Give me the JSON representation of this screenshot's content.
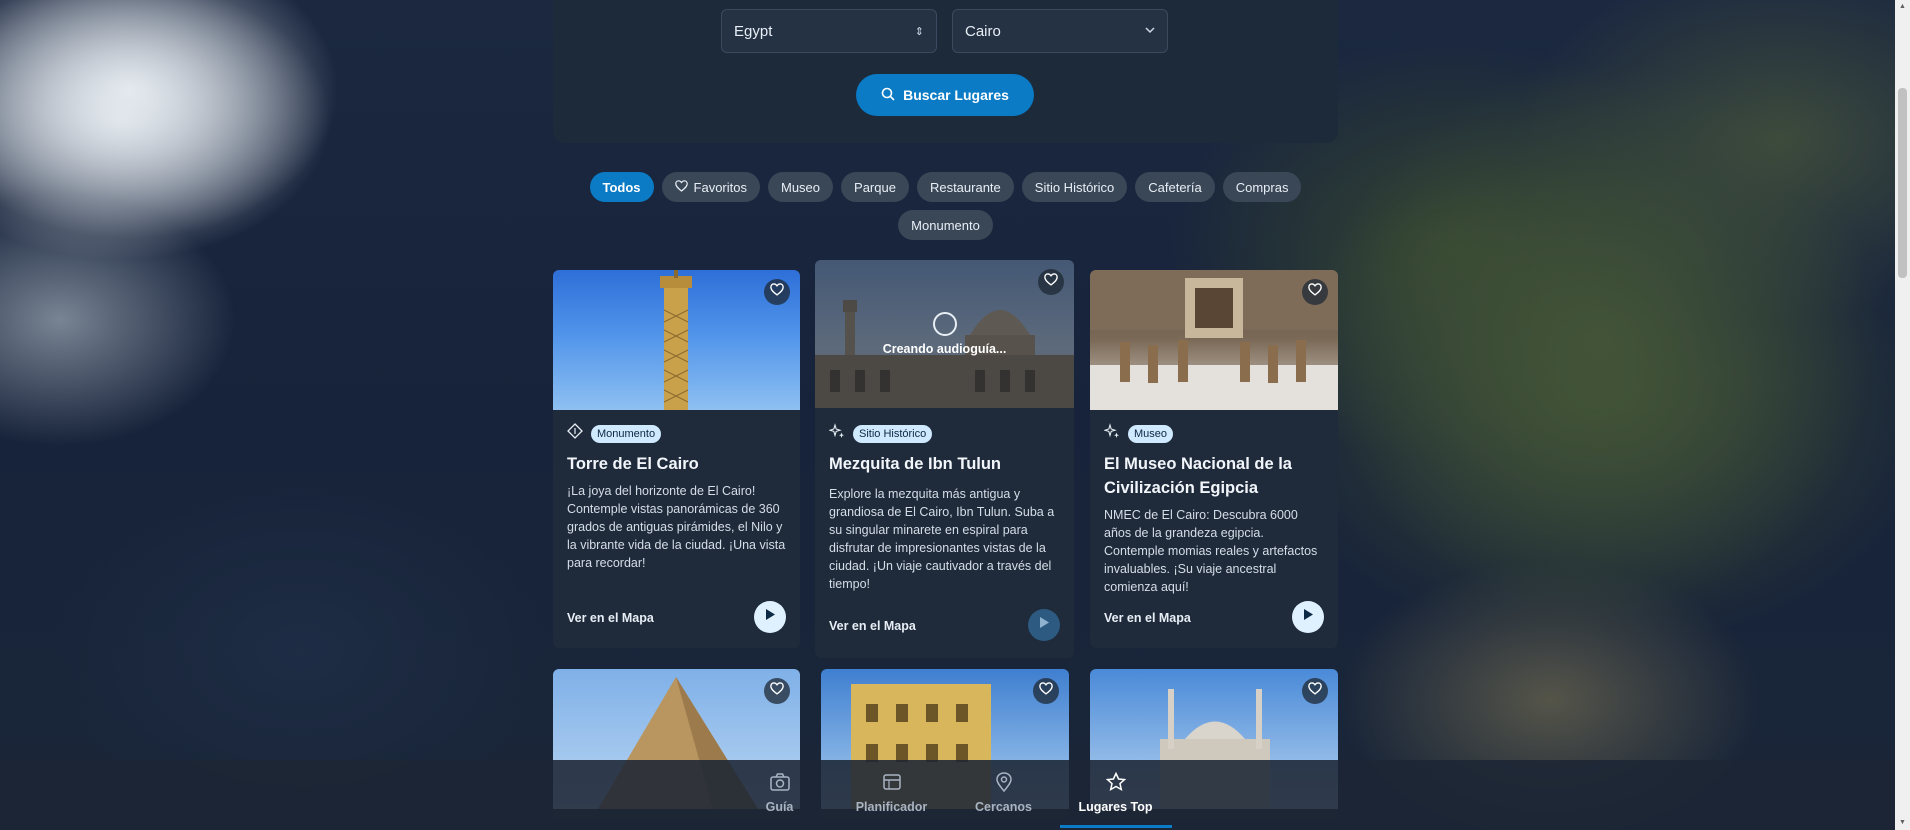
{
  "search": {
    "country": "Egypt",
    "city": "Cairo",
    "button_label": "Buscar Lugares"
  },
  "filters": {
    "active": "Todos",
    "items": [
      "Todos",
      "Favoritos",
      "Museo",
      "Parque",
      "Restaurante",
      "Sitio Histórico",
      "Cafetería",
      "Compras",
      "Monumento"
    ]
  },
  "cards": [
    {
      "category": "Monumento",
      "title": "Torre de El Cairo",
      "description": "¡La joya del horizonte de El Cairo! Contemple vistas panorámicas de 360 grados de antiguas pirámides, el Nilo y la vibrante vida de la ciudad. ¡Una vista para recordar!",
      "map_link": "Ver en el Mapa"
    },
    {
      "category": "Sitio Histórico",
      "title": "Mezquita de Ibn Tulun",
      "description": "Explore la mezquita más antigua y grandiosa de El Cairo, Ibn Tulun. Suba a su singular minarete en espiral para disfrutar de impresionantes vistas de la ciudad. ¡Un viaje cautivador a través del tiempo!",
      "map_link": "Ver en el Mapa",
      "loading_text": "Creando audioguía..."
    },
    {
      "category": "Museo",
      "title": "El Museo Nacional de la Civilización Egipcia",
      "description": "NMEC de El Cairo: Descubra 6000 años de la grandeza egipcia. Contemple momias reales y artefactos invaluables. ¡Su viaje ancestral comienza aquí!",
      "map_link": "Ver en el Mapa"
    }
  ],
  "nav": {
    "items": [
      "Guía",
      "Planificador",
      "Cercanos",
      "Lugares Top"
    ],
    "active": "Lugares Top"
  },
  "colors": {
    "accent": "#0a7bc4",
    "badge": "#cfe9ff",
    "card_bg": "#1f2b3b"
  }
}
